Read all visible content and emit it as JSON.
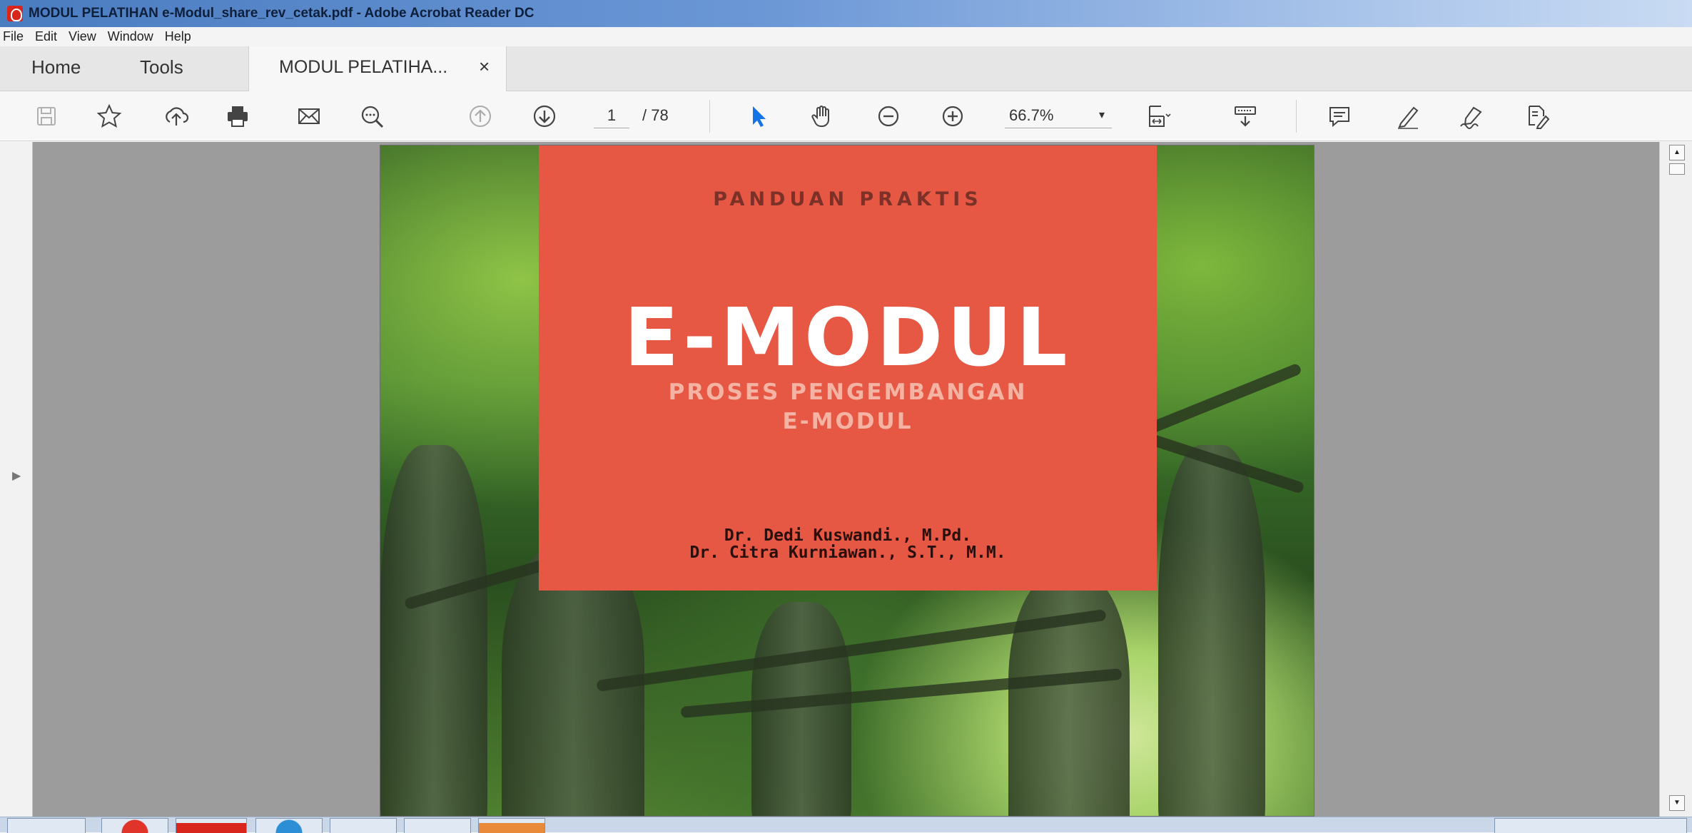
{
  "window": {
    "title": "MODUL PELATIHAN e-Modul_share_rev_cetak.pdf - Adobe Acrobat Reader DC"
  },
  "menu": [
    "File",
    "Edit",
    "View",
    "Window",
    "Help"
  ],
  "tabs": {
    "home": "Home",
    "tools": "Tools",
    "document": "MODUL PELATIHA...",
    "close_glyph": "×"
  },
  "toolbar": {
    "page_current": "1",
    "page_total": "/ 78",
    "zoom": "66.7%",
    "zoom_chevron": "▾",
    "icons": [
      "save-icon",
      "bookmark-star-icon",
      "upload-cloud-icon",
      "print-icon",
      "email-icon",
      "find-zoom-icon",
      "previous-page-icon",
      "next-page-icon",
      "select-cursor-icon",
      "hand-icon",
      "zoom-out-icon",
      "zoom-in-icon",
      "fit-page-icon",
      "scroll-mode-icon",
      "comment-icon",
      "highlight-icon",
      "sign-icon",
      "more-tools-icon"
    ]
  },
  "document": {
    "kicker": "PANDUAN PRAKTIS",
    "title": "E-MODUL",
    "subtitle_line1": "PROSES PENGEMBANGAN",
    "subtitle_line2": "E-MODUL",
    "author1": "Dr. Dedi Kuswandi., M.Pd.",
    "author2": "Dr. Citra Kurniawan., S.T., M.M.",
    "cover_color": "#e65844"
  },
  "sidebar": {
    "expand_glyph": "▶"
  },
  "scrollbar": {
    "up_glyph": "▲",
    "down_glyph": "▼"
  }
}
